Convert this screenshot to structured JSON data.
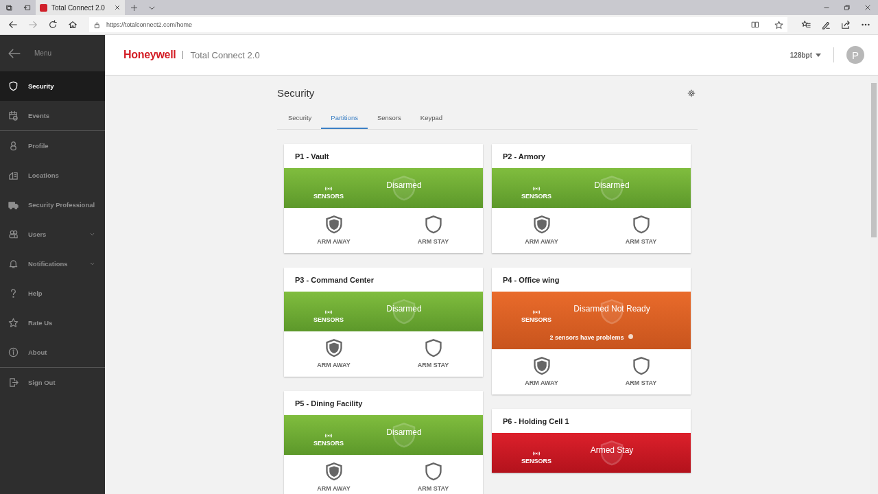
{
  "browser": {
    "tab_title": "Total Connect 2.0",
    "url": "https://totalconnect2.com/home"
  },
  "header": {
    "brand": "Honeywell",
    "product": "Total Connect 2.0",
    "user": "128bpt",
    "avatar_letter": "P"
  },
  "sidebar": {
    "menu_label": "Menu",
    "sections": [
      [
        {
          "label": "Security",
          "selected": true,
          "has_submenu": false
        },
        {
          "label": "Events",
          "selected": false,
          "has_submenu": false
        }
      ],
      [
        {
          "label": "Profile",
          "selected": false,
          "has_submenu": false
        },
        {
          "label": "Locations",
          "selected": false,
          "has_submenu": false
        },
        {
          "label": "Security Professional",
          "selected": false,
          "has_submenu": false
        },
        {
          "label": "Users",
          "selected": false,
          "has_submenu": true
        },
        {
          "label": "Notifications",
          "selected": false,
          "has_submenu": true
        },
        {
          "label": "Help",
          "selected": false,
          "has_submenu": false
        },
        {
          "label": "Rate Us",
          "selected": false,
          "has_submenu": false
        },
        {
          "label": "About",
          "selected": false,
          "has_submenu": false
        }
      ],
      [
        {
          "label": "Sign Out",
          "selected": false,
          "has_submenu": false
        }
      ]
    ]
  },
  "page": {
    "title": "Security",
    "tabs": [
      {
        "label": "Security",
        "selected": false
      },
      {
        "label": "Partitions",
        "selected": true
      },
      {
        "label": "Sensors",
        "selected": false
      },
      {
        "label": "Keypad",
        "selected": false
      }
    ],
    "partitions": [
      {
        "name": "P1 - Vault",
        "kind": "disarmed",
        "status": "Disarmed",
        "sensors_label": "SENSORS",
        "actions": [
          "ARM AWAY",
          "ARM STAY"
        ]
      },
      {
        "name": "P2 - Armory",
        "kind": "disarmed",
        "status": "Disarmed",
        "sensors_label": "SENSORS",
        "actions": [
          "ARM AWAY",
          "ARM STAY"
        ]
      },
      {
        "name": "P3 - Command Center",
        "kind": "disarmed",
        "status": "Disarmed",
        "sensors_label": "SENSORS",
        "actions": [
          "ARM AWAY",
          "ARM STAY"
        ]
      },
      {
        "name": "P4 - Office wing",
        "kind": "not_ready",
        "status": "Disarmed Not Ready",
        "sensors_label": "SENSORS",
        "problem": "2 sensors have problems",
        "actions": [
          "ARM AWAY",
          "ARM STAY"
        ]
      },
      {
        "name": "P5 - Dining Facility",
        "kind": "disarmed",
        "status": "Disarmed",
        "sensors_label": "SENSORS",
        "actions": [
          "ARM AWAY",
          "ARM STAY"
        ]
      },
      {
        "name": "P6 - Holding Cell 1",
        "kind": "armed",
        "status": "Armed Stay",
        "sensors_label": "SENSORS"
      }
    ]
  }
}
